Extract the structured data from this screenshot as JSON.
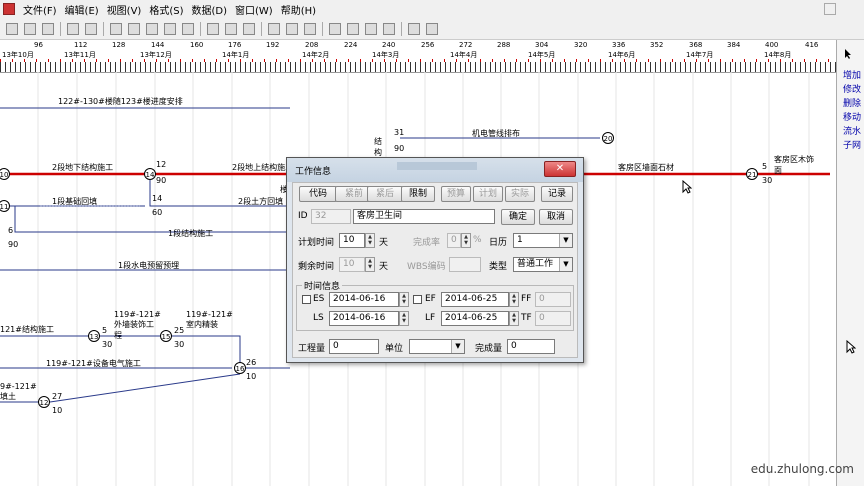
{
  "menubar": {
    "items": [
      "文件(F)",
      "编辑(E)",
      "视图(V)",
      "格式(S)",
      "数据(D)",
      "窗口(W)",
      "帮助(H)"
    ]
  },
  "ruler": {
    "days": [
      "96",
      "112",
      "128",
      "144",
      "160",
      "176",
      "192",
      "208",
      "224",
      "240",
      "256",
      "272",
      "288",
      "304",
      "320",
      "336",
      "352",
      "368",
      "384",
      "400",
      "416"
    ],
    "months": [
      "13年10月",
      "13年11月",
      "13年12月",
      "14年1月",
      "14年2月",
      "14年3月",
      "14年4月",
      "14年5月",
      "14年6月",
      "14年7月",
      "14年8月"
    ]
  },
  "sidebar": {
    "items": [
      "增加",
      "修改",
      "删除",
      "移动",
      "流水",
      "子网"
    ]
  },
  "network": {
    "labels": {
      "l1": "122#-130#楼随123#楼进度安排",
      "l2": "2段地下结构施工",
      "l3": "2段地上结构施工",
      "l4": "1段基础回填",
      "l5": "2段土方回填",
      "l6": "1段结构施工",
      "l7": "1段水电预留预埋",
      "l8": "机电管线排布",
      "l9": "客房区墙面石材",
      "l10": "客房区木饰面",
      "l11": "121#结构施工",
      "l12": "119#-121#外墙装饰工程",
      "l13": "119#-121#室内精装",
      "l14": "119#-121#设备电气施工",
      "l15": "9#-121#填土",
      "l16": "结构施",
      "l17": "楼"
    },
    "nodes": [
      "10",
      "11",
      "12",
      "13",
      "14",
      "15",
      "16",
      "20",
      "21"
    ],
    "numbers": {
      "n1": "12",
      "n2": "90",
      "n3": "14",
      "n4": "60",
      "n5": "6",
      "n6": "90",
      "n7": "31",
      "n8": "90",
      "n9": "25",
      "n10": "30",
      "n11": "5",
      "n12": "30",
      "n13": "26",
      "n14": "10",
      "n15": "27",
      "n16": "10",
      "n17": "5",
      "n18": "30"
    }
  },
  "dialog": {
    "title": "工作信息",
    "close_label": "✕",
    "buttons": {
      "code": "代码",
      "before": "紧前",
      "after": "紧后",
      "limit": "限制",
      "budget": "预算",
      "plan": "计划",
      "actual": "实际",
      "record": "记录",
      "ok": "确定",
      "cancel": "取消"
    },
    "id_label": "ID",
    "id_value": "32",
    "name_value": "客房卫生间",
    "plan_time_label": "计划时间",
    "plan_time_value": "10",
    "plan_time_unit": "天",
    "complete_rate_label": "完成率",
    "complete_rate_value": "0",
    "complete_rate_unit": "%",
    "calendar_label": "日历",
    "calendar_value": "1",
    "remain_label": "剩余时间",
    "remain_value": "10",
    "remain_unit": "天",
    "wbs_label": "WBS编码",
    "wbs_value": "",
    "type_label": "类型",
    "type_value": "普通工作",
    "time_group_label": "时间信息",
    "es_label": "ES",
    "es_value": "2014-06-16",
    "ef_label": "EF",
    "ef_value": "2014-06-25",
    "ff_label": "FF",
    "ff_value": "0",
    "ls_label": "LS",
    "ls_value": "2014-06-16",
    "lf_label": "LF",
    "lf_value": "2014-06-25",
    "tf_label": "TF",
    "tf_value": "0",
    "quantity_label": "工程量",
    "quantity_value": "0",
    "unit_label": "单位",
    "unit_value": "",
    "done_label": "完成量",
    "done_value": "0"
  },
  "watermark": "edu.zhulong.com",
  "colors": {
    "critical_line": "#cc0000",
    "normal_line": "#2a3a8a",
    "dialog_border": "#555555"
  }
}
